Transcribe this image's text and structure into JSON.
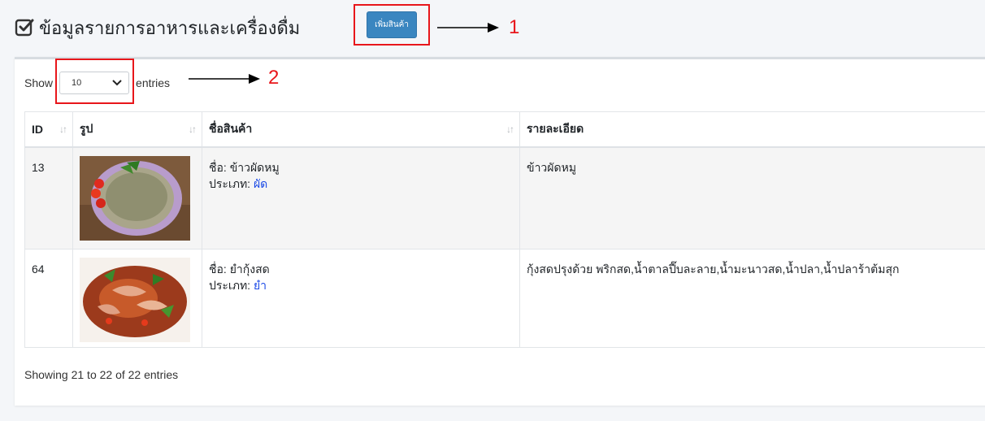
{
  "header": {
    "title": "ข้อมูลรายการอาหารและเครื่องดื่ม",
    "add_button_label": "เพิ่มสินค้า"
  },
  "annotations": {
    "label_1": "1",
    "label_2": "2"
  },
  "length_menu": {
    "show_label": "Show",
    "selected": "10",
    "entries_label": "entries"
  },
  "table": {
    "headers": [
      "ID",
      "รูป",
      "ชื่อสินค้า",
      "รายละเอียด"
    ],
    "rows": [
      {
        "id": "13",
        "image_icon": "food-photo-fried-rice",
        "name_label": "ชื่อ: ข้าวผัดหมู",
        "type_label": "ประเภท: ",
        "type_value": "ผัด",
        "detail": "ข้าวผัดหมู"
      },
      {
        "id": "64",
        "image_icon": "food-photo-spicy-shrimp-salad",
        "name_label": "ชื่อ: ยำกุ้งสด",
        "type_label": "ประเภท: ",
        "type_value": "ยำ",
        "detail": "กุ้งสดปรุงด้วย พริกสด,น้ำตาลปี๊บละลาย,น้ำมะนาวสด,น้ำปลา,น้ำปลาร้าต้มสุก"
      }
    ]
  },
  "footer": {
    "info": "Showing 21 to 22 of 22 entries"
  },
  "colors": {
    "accent": "#3a86c0",
    "annotation": "#e8161b",
    "link": "#1a49e6"
  }
}
